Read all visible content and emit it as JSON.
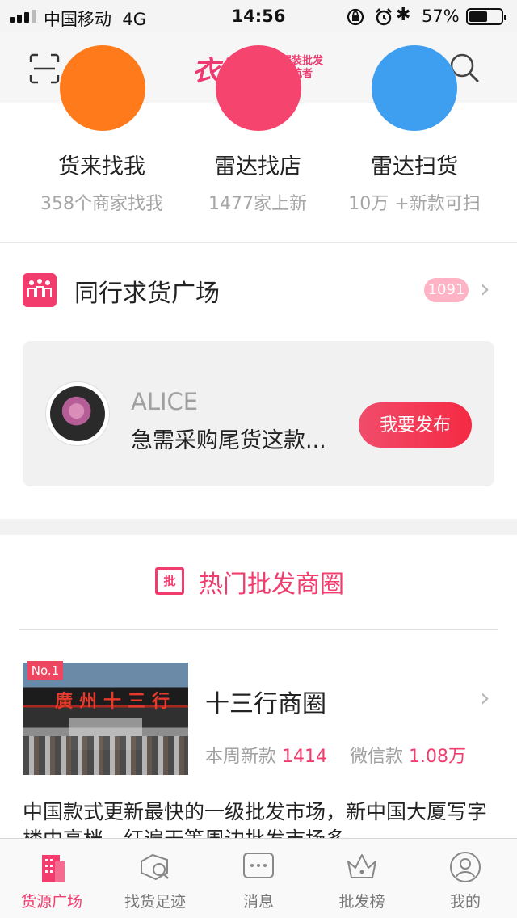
{
  "status_bar": {
    "carrier": "中国移动",
    "network": "4G",
    "time": "14:56",
    "battery_percent": "57%",
    "battery_level": 0.57
  },
  "header": {
    "logo_text": "衣联",
    "logo_sub_line1": "中国服装批发",
    "logo_sub_line2": "新的领航者",
    "left_icon": "scan-icon",
    "right_icon": "search-icon",
    "brand_color": "#ec3a71"
  },
  "quick_actions": [
    {
      "title": "货来找我",
      "subtitle": "358个商家找我",
      "color": "#ff7a1a"
    },
    {
      "title": "雷达找店",
      "subtitle": "1477家上新",
      "color": "#f5456f"
    },
    {
      "title": "雷达扫货",
      "subtitle": "10万 +新款可扫",
      "color": "#3e9ef0"
    }
  ],
  "peer_section": {
    "title": "同行求货广场",
    "badge_count": "1091",
    "card": {
      "name": "ALICE",
      "message": "急需采购尾货这款...",
      "button_label": "我要发布"
    }
  },
  "hot_section": {
    "icon_char": "批",
    "title": "热门批发商圈"
  },
  "market": {
    "rank": "No.1",
    "name": "十三行商圈",
    "weekly_label": "本周新款",
    "weekly_value": "1414",
    "wechat_label": "微信款",
    "wechat_value": "1.08万",
    "description": "中国款式更新最快的一级批发市场，新中国大厦写字楼中高档，红遍天等周边批发市场多"
  },
  "tabbar": [
    {
      "label": "货源广场",
      "icon": "building-icon",
      "active": true
    },
    {
      "label": "找货足迹",
      "icon": "footprint-search-icon",
      "active": false
    },
    {
      "label": "消息",
      "icon": "message-icon",
      "active": false
    },
    {
      "label": "批发榜",
      "icon": "crown-icon",
      "active": false
    },
    {
      "label": "我的",
      "icon": "profile-icon",
      "active": false
    }
  ],
  "accent_color": "#f23c6e"
}
